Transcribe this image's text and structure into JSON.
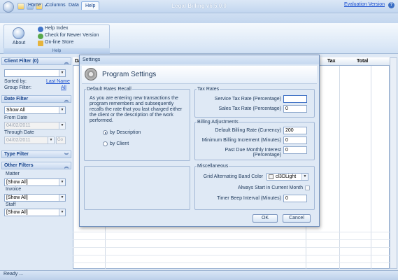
{
  "app": {
    "title": "Legal Billing v6.5.0.0"
  },
  "ribbon": {
    "tabs": [
      "Home",
      "Columns",
      "Data",
      "Help"
    ],
    "active_tab": "Help",
    "evaluation_link": "Evaluation Version",
    "help_group": {
      "about_label": "About",
      "items": [
        "Help Index",
        "Check for Newer Version",
        "On-line Store"
      ],
      "caption": "Help"
    }
  },
  "sidebar": {
    "client_filter": {
      "title": "Client Filter (0)",
      "value": "",
      "sorted_by_label": "Sorted by:",
      "sorted_by_value": "Last Name",
      "group_filter_label": "Group Filter:",
      "group_filter_value": "All"
    },
    "date_filter": {
      "title": "Date Filter",
      "value": "Show All",
      "from_label": "From Date",
      "from_value": "04/02/2011",
      "through_label": "Through Date",
      "through_value": "04/02/2011",
      "go_label": "Go"
    },
    "type_filter": {
      "title": "Type Filter"
    },
    "other_filters": {
      "title": "Other Filters",
      "matter_label": "Matter",
      "matter_value": "[Show All]",
      "invoice_label": "Invoice",
      "invoice_value": "[Show All]",
      "staff_label": "Staff",
      "staff_value": "[Show All]"
    }
  },
  "grid": {
    "columns": [
      "Da",
      "Tax",
      "Total"
    ]
  },
  "status": {
    "text": "Ready ..."
  },
  "dialog": {
    "window_title": "Settings",
    "header": "Program Settings",
    "default_rates_recall": {
      "legend": "Default Rates Recall",
      "description": "As you are entering new transactions the program remembers and subsequently recalls the rate that you last charged either the client or the description of the work performed.",
      "options": [
        "by Description",
        "by Client"
      ],
      "selected": "by Description"
    },
    "tax_rates": {
      "legend": "Tax Rates",
      "service_label": "Service Tax Rate (Percentage)",
      "service_value": "",
      "sales_label": "Sales Tax Rate (Percentage)",
      "sales_value": "0"
    },
    "billing_adjustments": {
      "legend": "Billing Adjustments",
      "default_rate_label": "Default Billing Rate (Currency)",
      "default_rate_value": "200",
      "min_increment_label": "Minimum Billing Increment (Minutes)",
      "min_increment_value": "0",
      "past_due_label": "Past Due Monthly Interest (Percentage)",
      "past_due_value": "0"
    },
    "miscellaneous": {
      "legend": "Miscellaneous",
      "band_color_label": "Grid Alternating Band Color",
      "band_color_value": "cl3DLight",
      "always_start_label": "Always Start in Current Month",
      "always_start_checked": false,
      "beep_label": "Timer Beep Interval (Minutes)",
      "beep_value": "0"
    },
    "ok_label": "OK",
    "cancel_label": "Cancel"
  }
}
